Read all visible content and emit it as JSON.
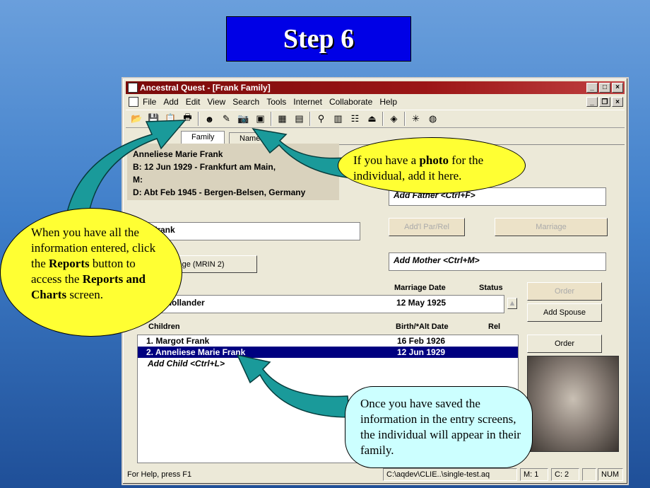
{
  "slide": {
    "title": "Step 6"
  },
  "window": {
    "title": "Ancestral Quest - [Frank Family]",
    "menu": [
      "File",
      "Add",
      "Edit",
      "View",
      "Search",
      "Tools",
      "Internet",
      "Collaborate",
      "Help"
    ]
  },
  "tabs": [
    "Family",
    "Name"
  ],
  "individual": {
    "name": "Anneliese Marie Frank",
    "birth": "B: 12 Jun 1929 - Frankfurt am Main,",
    "marriage": "M:",
    "death": "D: Abt Feb 1945 - Bergen-Belsen, Germany"
  },
  "father_field": "Otto Frank",
  "add_father": "Add Father <Ctrl+F>",
  "add_mother": "Add Mother <Ctrl+M>",
  "add_par_rel": "Add'l Par/Rel",
  "marriage_btn": "Marriage",
  "marriage_mrin_btn": "Marriage (MRIN 2)",
  "spouse_headers": {
    "marriage_date": "Marriage Date",
    "status": "Status"
  },
  "spouse": {
    "name": "Edith Hollander",
    "date": "12  May  1925"
  },
  "order_btn": "Order",
  "add_spouse_btn": "Add Spouse",
  "children_header": {
    "label": "Children",
    "birth": "Birth/*Alt Date",
    "rel": "Rel"
  },
  "children": [
    {
      "label": "1.   Margot Frank",
      "birth": "16  Feb   1926"
    },
    {
      "label": "2.   Anneliese Marie Frank",
      "birth": "12  Jun   1929"
    }
  ],
  "add_child": "Add Child <Ctrl+L>",
  "statusbar": {
    "help": "For Help, press F1",
    "path": "C:\\aqdev\\CLIE..\\single-test.aq",
    "m": "M: 1",
    "c": "C: 2",
    "num": "NUM"
  },
  "callouts": {
    "reports_pre": "When you have all the information entered, click the ",
    "reports_bold1": "Reports",
    "reports_mid": " button to access the ",
    "reports_bold2": "Reports and Charts",
    "reports_post": " screen.",
    "photo_pre": "If you have a ",
    "photo_bold": "photo",
    "photo_post": " for the individual, add it here.",
    "saved": "Once you have saved the information in the entry screens, the individual will appear in their family."
  }
}
